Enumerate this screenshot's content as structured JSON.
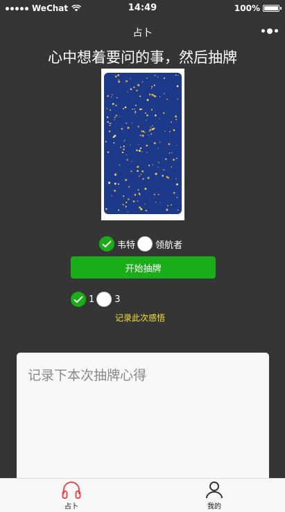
{
  "status_bar": {
    "carrier": "WeChat",
    "time": "14:49",
    "battery": "100%",
    "battery_level": 1.0
  },
  "nav": {
    "title": "占卜",
    "more_icon": "more-dots-icon"
  },
  "prompt": "心中想着要问的事，然后抽牌",
  "card": {
    "image": "star-pattern-card-back"
  },
  "deck_options": [
    {
      "label": "韦特",
      "checked": true
    },
    {
      "label": "领航者",
      "checked": false
    }
  ],
  "start_button": "开始抽牌",
  "count_options": [
    {
      "label": "1",
      "checked": true
    },
    {
      "label": "3",
      "checked": false
    }
  ],
  "record_link": "记录此次感悟",
  "notes": {
    "placeholder": "记录下本次抽牌心得"
  },
  "tabbar": [
    {
      "label": "占卜",
      "icon": "headphones-icon",
      "active": true,
      "color": "#e84a4a"
    },
    {
      "label": "我的",
      "icon": "user-icon",
      "active": false,
      "color": "#333333"
    }
  ],
  "colors": {
    "background": "#353535",
    "accent": "#1aad19",
    "link": "#f5e53a"
  }
}
